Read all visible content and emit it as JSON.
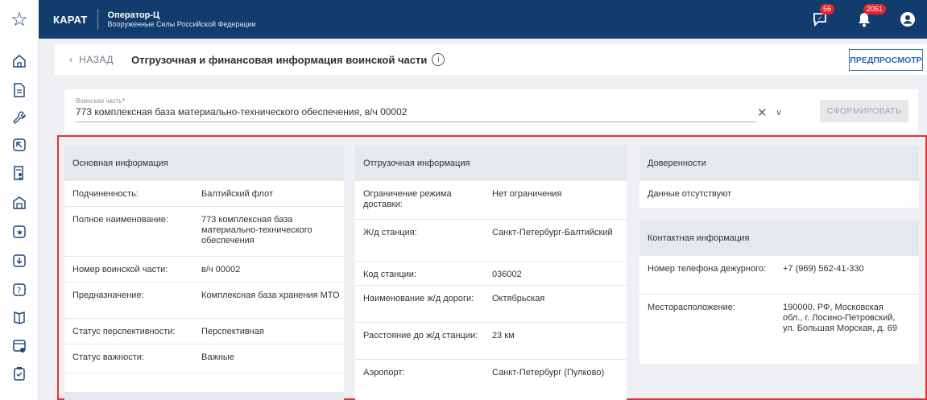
{
  "topbar": {
    "logo": "КАРАТ",
    "org_title": "Оператор-Ц",
    "org_subtitle": "Вооруженные Силы Российской Федерации",
    "messages_badge": "56",
    "notifications_badge": "2061"
  },
  "header": {
    "back_label": "НАЗАД",
    "title": "Отгрузочная и финансовая информация воинской части",
    "preview_label": "ПРЕДПРОСМОТР"
  },
  "unit_select": {
    "label": "Воинская часть",
    "required_mark": "*",
    "value": "773 комплексная база материально-технического обеспечения, в/ч 00002",
    "form_button": "СФОРМИРОВАТЬ"
  },
  "basic": {
    "title": "Основная информация",
    "rows": [
      {
        "k": "Подчиненность:",
        "v": "Балтийский флот"
      },
      {
        "k": "Полное наименование:",
        "v": "773 комплексная база материально-технического обеспечения"
      },
      {
        "k": "Номер воинской части:",
        "v": "в/ч 00002"
      },
      {
        "k": "Предназначение:",
        "v": "Комплексная база хранения МТО"
      },
      {
        "k": "Статус перспективности:",
        "v": "Перспективная"
      },
      {
        "k": "Статус важности:",
        "v": "Важные"
      }
    ]
  },
  "shipping": {
    "title": "Отгрузочная информация",
    "rows": [
      {
        "k": "Ограничение режима доставки:",
        "v": "Нет ограничения"
      },
      {
        "k": "Ж/д станция:",
        "v": "Санкт-Петербург-Балтийский"
      },
      {
        "k": "Код станции:",
        "v": "036002"
      },
      {
        "k": "Наименование ж/д дороги:",
        "v": "Октябрьская"
      },
      {
        "k": "Расстояние до ж/д станции:",
        "v": "23 км"
      },
      {
        "k": "Аэропорт:",
        "v": "Санкт-Петербург (Пулково)"
      }
    ]
  },
  "proxies": {
    "title": "Доверенности",
    "empty": "Данные отсутствуют"
  },
  "contacts": {
    "title": "Контактная информация",
    "rows": [
      {
        "k": "Номер телефона дежурного:",
        "v": "+7 (969) 562-41-330"
      },
      {
        "k": "Месторасположение:",
        "v": "190000, РФ, Московская обл., г. Лосино-Петровский, ул. Большая Морская, д. 69"
      }
    ]
  }
}
